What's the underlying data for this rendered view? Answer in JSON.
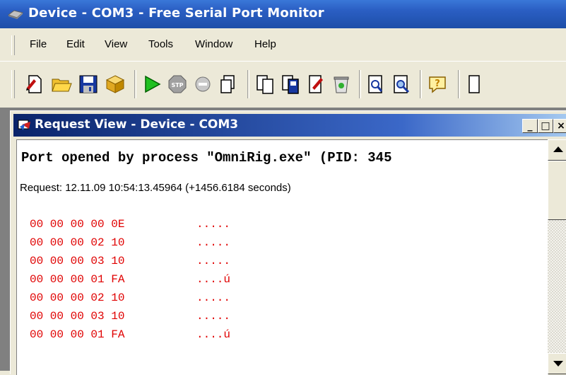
{
  "app": {
    "title": "Device - COM3 - Free Serial Port Monitor"
  },
  "menu": {
    "items": [
      "File",
      "Edit",
      "View",
      "Tools",
      "Window",
      "Help"
    ]
  },
  "toolbar": {
    "buttons": [
      {
        "name": "new-session-icon"
      },
      {
        "name": "open-folder-icon"
      },
      {
        "name": "save-icon"
      },
      {
        "name": "package-icon"
      },
      {
        "name": "start-icon"
      },
      {
        "name": "stop-icon"
      },
      {
        "name": "pause-icon"
      },
      {
        "name": "copy-icon"
      },
      {
        "name": "pages-icon"
      },
      {
        "name": "paste-icon"
      },
      {
        "name": "edit-icon"
      },
      {
        "name": "delete-icon"
      },
      {
        "name": "find-icon"
      },
      {
        "name": "find-next-icon"
      },
      {
        "name": "help-icon"
      },
      {
        "name": "about-icon"
      }
    ]
  },
  "child_window": {
    "title": "Request View - Device - COM3",
    "buttons": [
      "_",
      "□",
      "×"
    ],
    "port_line": "Port opened by process \"OmniRig.exe\" (PID: 345",
    "request_line": "Request: 12.11.09 10:54:13.45964 (+1456.6184 seconds)",
    "hex_rows": [
      {
        "hex": "00 00 00 00 0E",
        "ascii": "....."
      },
      {
        "hex": "00 00 00 02 10",
        "ascii": "....."
      },
      {
        "hex": "00 00 00 03 10",
        "ascii": "....."
      },
      {
        "hex": "00 00 00 01 FA",
        "ascii": "....ú"
      },
      {
        "hex": "00 00 00 02 10",
        "ascii": "....."
      },
      {
        "hex": "00 00 00 03 10",
        "ascii": "....."
      },
      {
        "hex": "00 00 00 01 FA",
        "ascii": "....ú"
      }
    ]
  },
  "colors": {
    "title_blue": "#2b5fc4",
    "child_title": "#0a246a",
    "hex_red": "#e00000"
  }
}
